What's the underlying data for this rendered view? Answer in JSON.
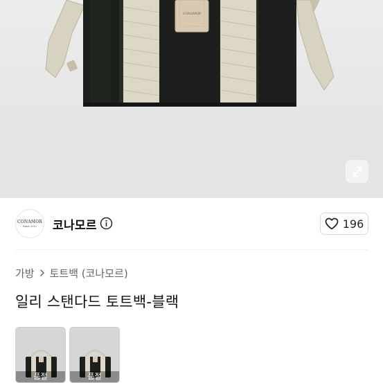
{
  "seller": {
    "name": "코나모르",
    "logo_text": "CONAMOR",
    "logo_subtext": "Since 2012"
  },
  "likes": {
    "count": "196"
  },
  "breadcrumb": {
    "category": "가방",
    "subcategory": "토트백 (코나모르)"
  },
  "product": {
    "title": "일리 스탠다드 토트백-블랙",
    "bag_tag_text": "CONAMOR"
  },
  "thumbnails": [
    {
      "status": "품절"
    },
    {
      "status": "품절"
    }
  ],
  "icons": {
    "expand": "expand-icon",
    "info": "info-icon",
    "heart": "heart-icon",
    "chevron": "chevron-right-icon"
  },
  "colors": {
    "bag_body": "#1c1f1c",
    "strap": "#d8d3c0",
    "tag": "#d9c9b3"
  }
}
